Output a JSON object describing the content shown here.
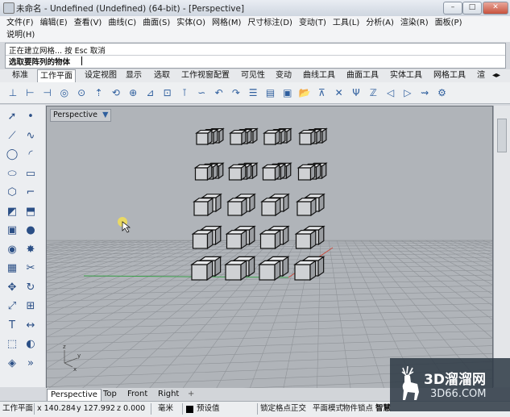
{
  "window": {
    "title": "未命名 - Undefined (Undefined) (64-bit) - [Perspective]",
    "minimize": "–",
    "maximize": "□",
    "close": "✕"
  },
  "menu": {
    "items": [
      "文件(F)",
      "编辑(E)",
      "查看(V)",
      "曲线(C)",
      "曲面(S)",
      "实体(O)",
      "网格(M)",
      "尺寸标注(D)",
      "变动(T)",
      "工具(L)",
      "分析(A)",
      "渲染(R)",
      "面板(P)",
      "说明(H)"
    ]
  },
  "command": {
    "history": "正在建立网格... 按 Esc 取消",
    "prompt": "选取要阵列的物体"
  },
  "tabs": {
    "items": [
      "标准",
      "工作平面",
      "设定视图",
      "显示",
      "选取",
      "工作视窗配置",
      "可见性",
      "变动",
      "曲线工具",
      "曲面工具",
      "实体工具",
      "网格工具",
      "渲"
    ],
    "active_index": 1
  },
  "toolbar": {
    "icons": [
      "cplane-world-top-icon",
      "cplane-front-icon",
      "cplane-right-icon",
      "cplane-sphere-icon",
      "cplane-object-icon",
      "cplane-elevation-icon",
      "cplane-rotate-icon",
      "cplane-origin-icon",
      "cplane-3point-icon",
      "cplane-view-icon",
      "cplane-vertical-icon",
      "cplane-curve-icon",
      "cplane-undo-icon",
      "cplane-redo-icon",
      "named-cplane-icon",
      "set-view-icon",
      "save-icon",
      "open-icon",
      "cplane-normal-icon",
      "cplane-x-icon",
      "cplane-y-icon",
      "cplane-z-icon",
      "cplane-previous-icon",
      "cplane-next-icon",
      "cplane-through-icon",
      "cplane-manage-icon"
    ]
  },
  "lefttools": {
    "icons": [
      "select-arrow-icon",
      "point-icon",
      "polyline-icon",
      "curve-icon",
      "circle-icon",
      "arc-icon",
      "ellipse-icon",
      "rectangle-icon",
      "polygon-icon",
      "fillet-curve-icon",
      "surface-icon",
      "extrude-icon",
      "box-icon",
      "sphere-icon",
      "boolean-union-icon",
      "explode-icon",
      "mesh-icon",
      "trim-icon",
      "move-icon",
      "rotate-icon",
      "scale-icon",
      "array-icon",
      "text-icon",
      "dimension-icon",
      "group-icon",
      "hide-icon",
      "render-icon",
      "more-icon"
    ]
  },
  "viewport": {
    "label": "Perspective",
    "dropdown": "▼"
  },
  "viewport_tabs": {
    "items": [
      "Perspective",
      "Top",
      "Front",
      "Right"
    ],
    "active_index": 0,
    "add": "+"
  },
  "status": {
    "cplane": "工作平面",
    "x": "x 140.284",
    "y": "y 127.992",
    "z": "z 0.000",
    "units": "毫米",
    "layer": "预设值",
    "snap": "锁定格点",
    "ortho": "正交",
    "planar": "平面模式",
    "osnap": "物件锁点",
    "smarttrack": "智慧"
  },
  "watermark": {
    "brand": "3D溜溜网",
    "url": "3D66.COM"
  },
  "colors": {
    "accent": "#2f5f9e",
    "viewport_bg": "#b0b4b9",
    "grid": "#8a8e93",
    "axis_x": "#c84b3d",
    "axis_y": "#3aa04a"
  }
}
